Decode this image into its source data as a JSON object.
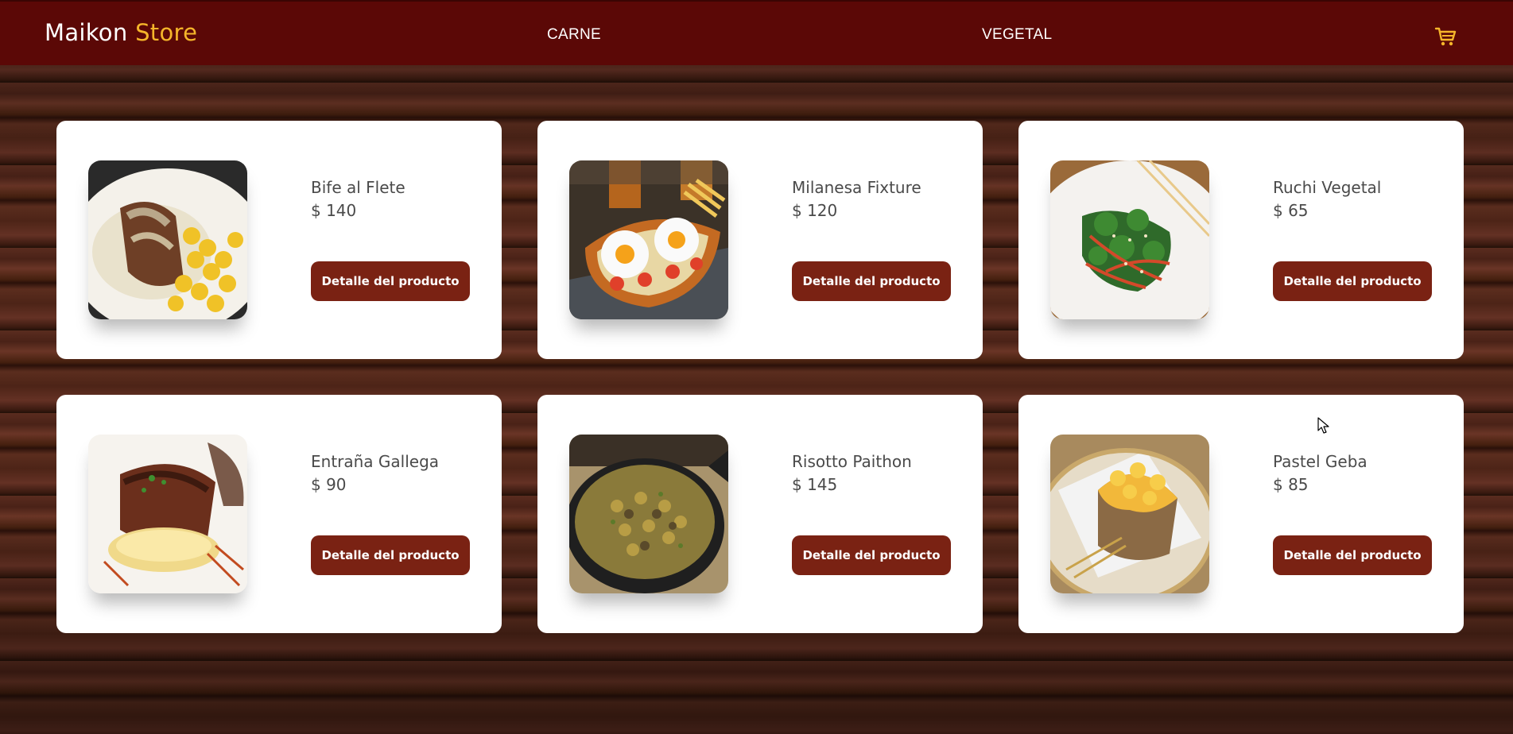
{
  "brand": {
    "name": "Maikon",
    "accent": "Store"
  },
  "nav": {
    "carne": "CARNE",
    "vegetal": "VEGETAL"
  },
  "cart_icon": "cart-icon",
  "colors": {
    "navbar": "#5b0806",
    "accent": "#f5b52a",
    "button": "#7a2213"
  },
  "products": [
    {
      "name": "Bife al Flete",
      "price": "$ 140",
      "button": "Detalle del producto"
    },
    {
      "name": "Milanesa Fixture",
      "price": "$ 120",
      "button": "Detalle del producto"
    },
    {
      "name": "Ruchi Vegetal",
      "price": "$ 65",
      "button": "Detalle del producto"
    },
    {
      "name": "Entraña Gallega",
      "price": "$ 90",
      "button": "Detalle del producto"
    },
    {
      "name": "Risotto Paithon",
      "price": "$ 145",
      "button": "Detalle del producto"
    },
    {
      "name": "Pastel Geba",
      "price": "$ 85",
      "button": "Detalle del producto"
    }
  ]
}
